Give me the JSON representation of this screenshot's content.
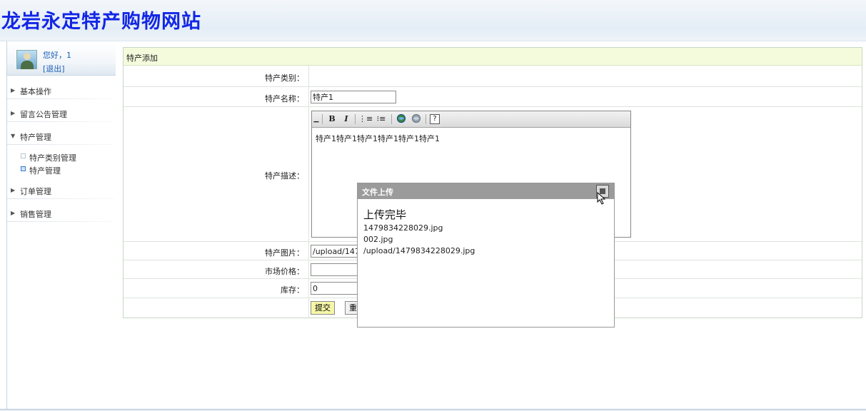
{
  "site_title": "龙岩永定特产购物网站",
  "user": {
    "greeting": "您好，1",
    "logout": "[退出]"
  },
  "sidebar": {
    "menu": [
      {
        "label": "基本操作",
        "arrow": "▶"
      },
      {
        "label": "留言公告管理",
        "arrow": "▶"
      },
      {
        "label": "特产管理",
        "arrow": "▼"
      },
      {
        "label": "订单管理",
        "arrow": "▶"
      },
      {
        "label": "销售管理",
        "arrow": "▶"
      }
    ],
    "sub_items": [
      {
        "label": "特产类别管理"
      },
      {
        "label": "特产管理"
      }
    ]
  },
  "form": {
    "section_title": "特产添加",
    "category_label": "特产类别：",
    "name_label": "特产名称：",
    "name_value": "特产1",
    "desc_label": "特产描述：",
    "desc_value": "特产1特产1特产1特产1特产1特产1",
    "image_label": "特产图片：",
    "image_value": "/upload/147",
    "price_label": "市场价格：",
    "price_value": "",
    "stock_label": "库存：",
    "stock_value": "0",
    "submit_label": "提交",
    "reset_label": "重"
  },
  "editor": {
    "toolbar": {
      "bold": "B",
      "italic": "I",
      "ordered_list": "⋮≡",
      "unordered_list": "⁝≡",
      "help": "?"
    }
  },
  "upload_popup": {
    "title": "文件上传",
    "status": "上传完毕",
    "lines": [
      "1479834228029.jpg",
      "002.jpg",
      "/upload/1479834228029.jpg"
    ]
  }
}
